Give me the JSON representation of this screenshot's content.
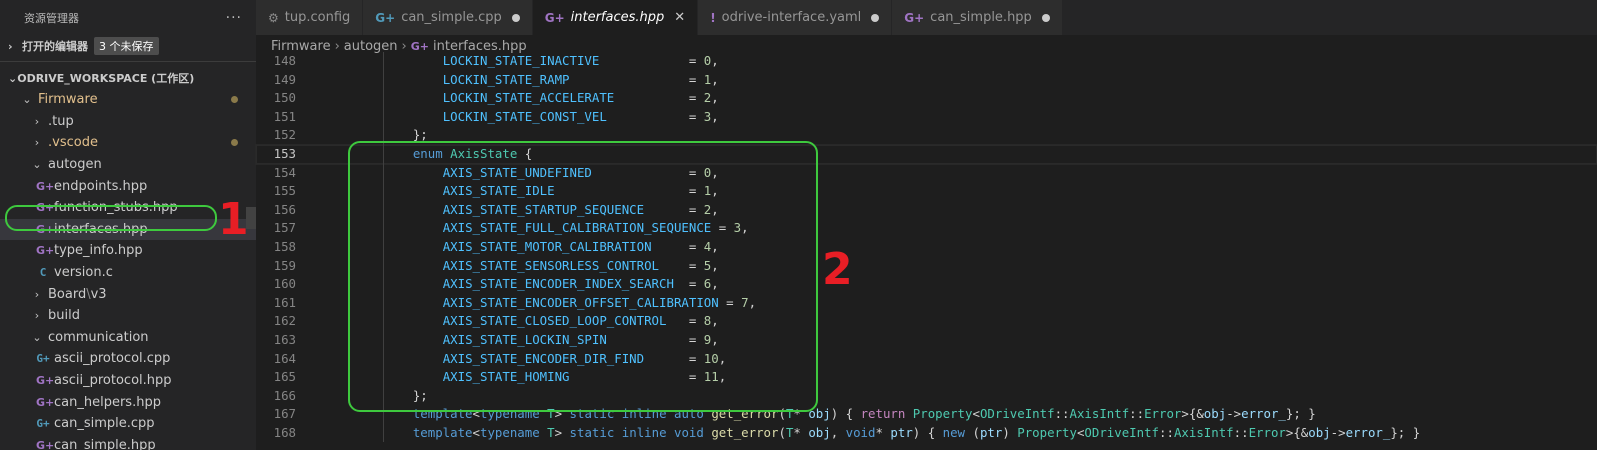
{
  "sidebar": {
    "title": "资源管理器",
    "more": "···",
    "open_editors": {
      "label": "打开的编辑器",
      "badge": "3 个未保存"
    },
    "workspace": {
      "label": "ODRIVE_WORKSPACE (工作区)"
    },
    "items": [
      {
        "label": "Firmware",
        "chev": "⌄",
        "icon": "",
        "modified": true
      },
      {
        "label": ".tup",
        "chev": "›",
        "icon": ""
      },
      {
        "label": ".vscode",
        "chev": "›",
        "icon": "",
        "modified": true
      },
      {
        "label": "autogen",
        "chev": "⌄",
        "icon": ""
      },
      {
        "label": "endpoints.hpp",
        "icon": "G+"
      },
      {
        "label": "function_stubs.hpp",
        "icon": "G+"
      },
      {
        "label": "interfaces.hpp",
        "icon": "G+"
      },
      {
        "label": "type_info.hpp",
        "icon": "G+"
      },
      {
        "label": "version.c",
        "icon": "C"
      },
      {
        "label": "Board",
        "label2": "v3",
        "chev": "›"
      },
      {
        "label": "build",
        "chev": "›"
      },
      {
        "label": "communication",
        "chev": "⌄"
      },
      {
        "label": "ascii_protocol.cpp",
        "icon": "G+"
      },
      {
        "label": "ascii_protocol.hpp",
        "icon": "G+"
      },
      {
        "label": "can_helpers.hpp",
        "icon": "G+"
      },
      {
        "label": "can_simple.cpp",
        "icon": "G+"
      },
      {
        "label": "can_simple.hpp",
        "icon": "G+"
      }
    ]
  },
  "tabs": [
    {
      "label": "tup.config",
      "icon": "⚙"
    },
    {
      "label": "can_simple.cpp",
      "icon": "G+"
    },
    {
      "label": "interfaces.hpp",
      "icon": "G+",
      "close": "✕"
    },
    {
      "label": "odrive-interface.yaml",
      "icon": "!"
    },
    {
      "label": "can_simple.hpp",
      "icon": "G+"
    }
  ],
  "breadcrumb": {
    "parts": [
      "Firmware",
      "autogen",
      "interfaces.hpp"
    ],
    "sep": "›",
    "icon": "G+"
  },
  "code": {
    "lines": [
      {
        "n": "148",
        "text": "        LOCKIN_STATE_INACTIVE            = 0,"
      },
      {
        "n": "149",
        "text": "        LOCKIN_STATE_RAMP                = 1,"
      },
      {
        "n": "150",
        "text": "        LOCKIN_STATE_ACCELERATE          = 2,"
      },
      {
        "n": "151",
        "text": "        LOCKIN_STATE_CONST_VEL           = 3,"
      },
      {
        "n": "152",
        "text": "    };"
      },
      {
        "n": "153",
        "text": "    enum AxisState {"
      },
      {
        "n": "154",
        "text": "        AXIS_STATE_UNDEFINED             = 0,"
      },
      {
        "n": "155",
        "text": "        AXIS_STATE_IDLE                  = 1,"
      },
      {
        "n": "156",
        "text": "        AXIS_STATE_STARTUP_SEQUENCE      = 2,"
      },
      {
        "n": "157",
        "text": "        AXIS_STATE_FULL_CALIBRATION_SEQUENCE = 3,"
      },
      {
        "n": "158",
        "text": "        AXIS_STATE_MOTOR_CALIBRATION     = 4,"
      },
      {
        "n": "159",
        "text": "        AXIS_STATE_SENSORLESS_CONTROL    = 5,"
      },
      {
        "n": "160",
        "text": "        AXIS_STATE_ENCODER_INDEX_SEARCH  = 6,"
      },
      {
        "n": "161",
        "text": "        AXIS_STATE_ENCODER_OFFSET_CALIBRATION = 7,"
      },
      {
        "n": "162",
        "text": "        AXIS_STATE_CLOSED_LOOP_CONTROL   = 8,"
      },
      {
        "n": "163",
        "text": "        AXIS_STATE_LOCKIN_SPIN           = 9,"
      },
      {
        "n": "164",
        "text": "        AXIS_STATE_ENCODER_DIR_FIND      = 10,"
      },
      {
        "n": "165",
        "text": "        AXIS_STATE_HOMING                = 11,"
      },
      {
        "n": "166",
        "text": "    };"
      },
      {
        "n": "167",
        "text": "    template<typename T> static inline auto get_error(T* obj) { return Property<ODriveIntf::AxisIntf::Error>{&obj->error_}; }"
      },
      {
        "n": "168",
        "text": "    template<typename T> static inline void get_error(T* obj, void* ptr) { new (ptr) Property<ODriveIntf::AxisIntf::Error>{&obj->error_}; }"
      }
    ]
  },
  "annotations": {
    "marker1": "1",
    "marker2": "2"
  },
  "colors": {
    "annotation_box": "#3ec93e",
    "annotation_number": "#e81e25",
    "cpp_icon": "#a074c4",
    "c_icon": "#519aba"
  }
}
